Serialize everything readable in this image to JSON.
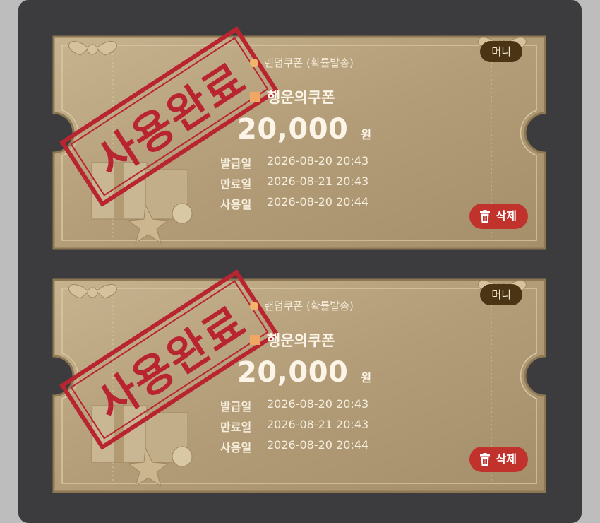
{
  "coupons": [
    {
      "badge": "머니",
      "subtitle": "랜덤쿠폰 (확률발송)",
      "title": "행운의쿠폰",
      "amount": "20,000",
      "unit": "원",
      "stamp": "사용완료",
      "rows": [
        {
          "label": "발급일",
          "value": "2026-08-20 20:43"
        },
        {
          "label": "만료일",
          "value": "2026-08-21 20:43"
        },
        {
          "label": "사용일",
          "value": "2026-08-20 20:44"
        }
      ],
      "delete_label": "삭제"
    },
    {
      "badge": "머니",
      "subtitle": "랜덤쿠폰 (확률발송)",
      "title": "행운의쿠폰",
      "amount": "20,000",
      "unit": "원",
      "stamp": "사용완료",
      "rows": [
        {
          "label": "발급일",
          "value": "2026-08-20 20:43"
        },
        {
          "label": "만료일",
          "value": "2026-08-21 20:43"
        },
        {
          "label": "사용일",
          "value": "2026-08-20 20:44"
        }
      ],
      "delete_label": "삭제"
    }
  ],
  "colors": {
    "panel": "#3c3c3e",
    "ticket": "#b8a27f",
    "stamp": "#b82530",
    "delete": "#c0322b",
    "badge": "#4a3414"
  }
}
